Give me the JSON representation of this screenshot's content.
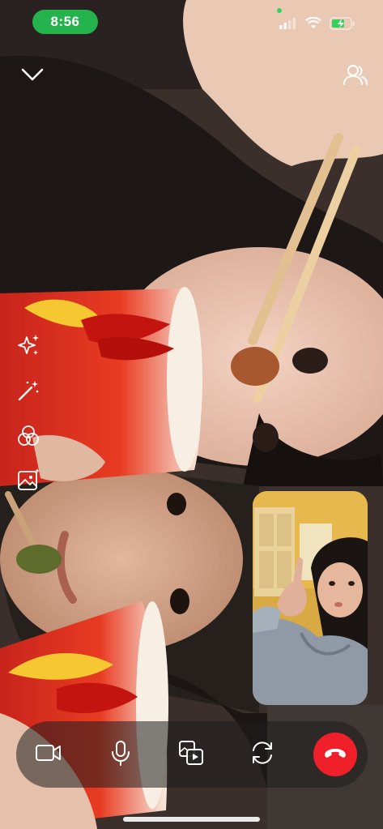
{
  "status_bar": {
    "time": "8:56",
    "accent_color": "#24b24c",
    "icons": [
      "cellular-signal-icon",
      "wifi-icon",
      "battery-charging-icon"
    ]
  },
  "top_controls": {
    "minimize": "chevron-down-icon",
    "participants": "participants-icon"
  },
  "side_tools": [
    "effects-sparkle-icon",
    "magic-wand-icon",
    "filters-icon",
    "backgrounds-icon"
  ],
  "call_controls": {
    "items": [
      "camera-icon",
      "microphone-icon",
      "share-screen-icon",
      "flip-camera-icon",
      "end-call-icon"
    ],
    "end_call_color": "#f0202a"
  }
}
